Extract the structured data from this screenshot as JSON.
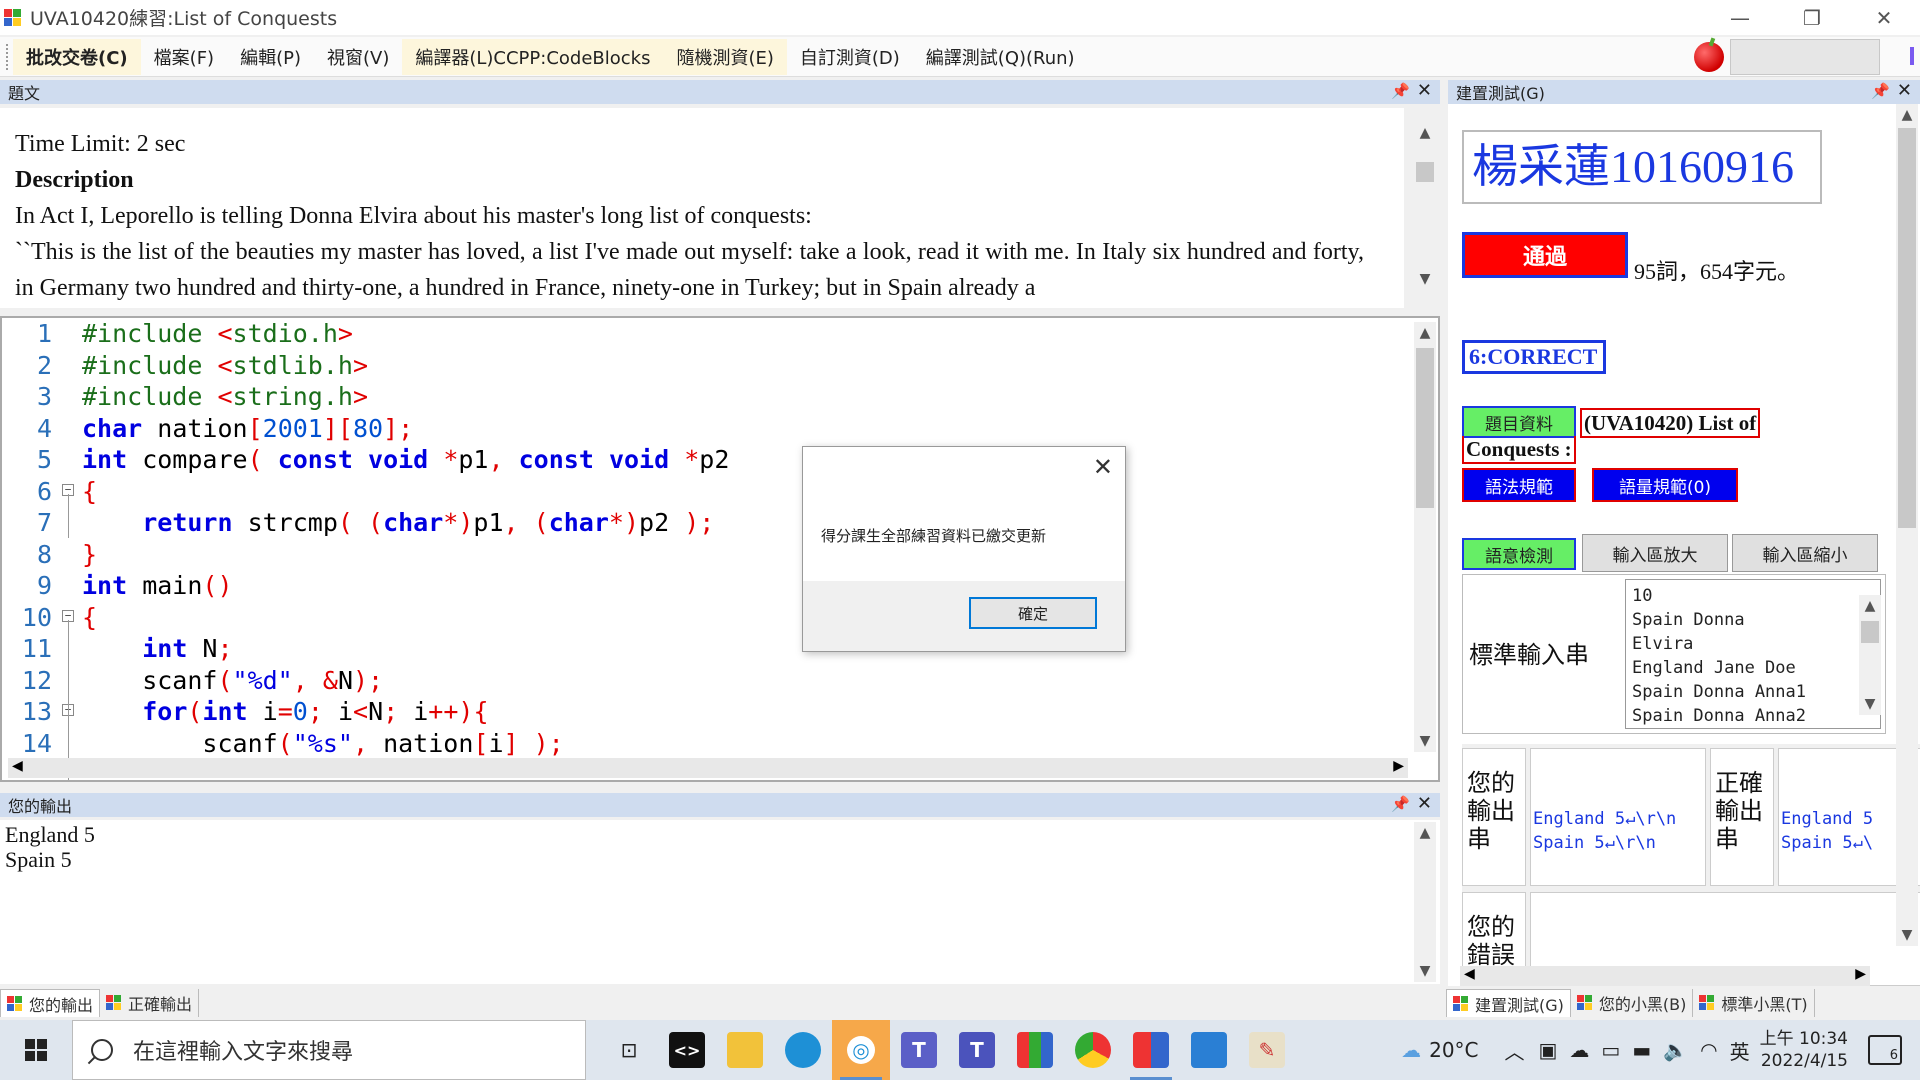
{
  "window": {
    "title": "UVA10420練習:List of Conquests",
    "controls": [
      "—",
      "❐",
      "✕"
    ]
  },
  "menu": {
    "items": [
      {
        "label": "批改交卷(C)",
        "highlight": true,
        "bold": true
      },
      {
        "label": "檔案(F)",
        "highlight": false,
        "bold": false
      },
      {
        "label": "編輯(P)",
        "highlight": false,
        "bold": false
      },
      {
        "label": "視窗(V)",
        "highlight": false,
        "bold": false
      },
      {
        "label": "編譯器(L)CCPP:CodeBlocks",
        "highlight": true,
        "bold": false
      },
      {
        "label": "隨機測資(E)",
        "highlight": true,
        "bold": false
      },
      {
        "label": "自訂測資(D)",
        "highlight": false,
        "bold": false
      },
      {
        "label": "編譯測試(Q)(Run)",
        "highlight": false,
        "bold": false
      }
    ]
  },
  "problem_panel": {
    "header": "題文",
    "time_limit": "Time Limit: 2 sec",
    "desc_title": "Description",
    "line1": "In Act I, Leporello is telling Donna Elvira about his master's long list of conquests:",
    "line2": "``This is the list of the beauties my master has loved, a list I've made out myself: take a look, read it with me. In Italy six hundred and forty, in Germany two hundred and thirty-one, a hundred in France, ninety-one in Turkey; but in Spain already a"
  },
  "code": {
    "line_numbers": [
      "1",
      "2",
      "3",
      "4",
      "5",
      "6",
      "7",
      "8",
      "9",
      "10",
      "11",
      "12",
      "13",
      "14"
    ]
  },
  "dialog": {
    "message": "得分課生全部練習資料已繳交更新",
    "ok_label": "確定"
  },
  "output_panel": {
    "header": "您的輸出",
    "lines": [
      "England 5",
      "Spain 5"
    ]
  },
  "bottom_tabs_left": [
    "您的輸出",
    "正確輸出"
  ],
  "bottom_tabs_right": [
    "建置測試(G)",
    "您的小黑(B)",
    "標準小黑(T)"
  ],
  "right_panel": {
    "header": "建置測試(G)",
    "student_name": "楊采蓮10160916",
    "pass_label": "通過",
    "stats": "95詞，654字元。",
    "result": "6:CORRECT",
    "problem_info_btn": "題目資料",
    "problem_title_1": "(UVA10420) List of",
    "problem_title_2": "Conquests :",
    "syntax_btn": "語法規範",
    "lexicon_btn": "語量規範(0)",
    "semantic_btn": "語意檢測",
    "enlarge_btn": "輸入區放大",
    "shrink_btn": "輸入區縮小",
    "std_input_label": "標準輸入串",
    "std_input": "10\nSpain Donna\nElvira\nEngland Jane Doe\nSpain Donna Anna1\nSpain Donna Anna2",
    "your_output_label": "您的\n輸出\n串",
    "your_output": "England 5↵\\r\\n\nSpain 5↵\\r\\n",
    "correct_output_label": "正確\n輸出\n串",
    "correct_output": "England 5\nSpain 5↵\\",
    "your_error_label": "您的\n錯誤"
  },
  "taskbar": {
    "search_placeholder": "在這裡輸入文字來搜尋",
    "weather": "20°C",
    "ime": "英",
    "time": "上午 10:34",
    "date": "2022/4/15",
    "notifications": "6"
  },
  "colors": {
    "accent_blue": "#1a38e0",
    "pass_red": "#ff0000",
    "green_button": "#66ee66",
    "panel_header": "#cfdcef"
  }
}
